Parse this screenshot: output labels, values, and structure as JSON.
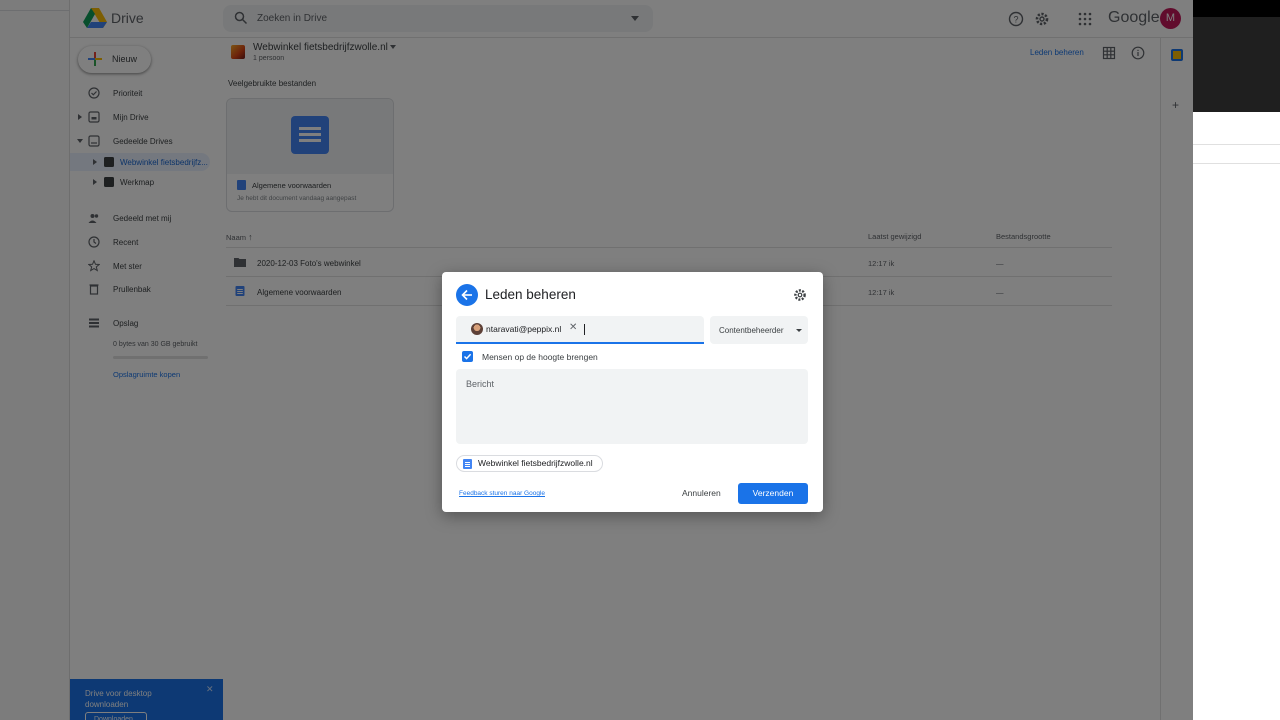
{
  "app": {
    "name": "Drive",
    "search_placeholder": "Zoeken in Drive",
    "brand": "Google",
    "avatar_initial": "M"
  },
  "sidebar": {
    "new_label": "Nieuw",
    "items": [
      {
        "label": "Prioriteit"
      },
      {
        "label": "Mijn Drive"
      },
      {
        "label": "Gedeelde Drives"
      },
      {
        "label": "Webwinkel fietsbedrijfz..."
      },
      {
        "label": "Werkmap"
      },
      {
        "label": "Gedeeld met mij"
      },
      {
        "label": "Recent"
      },
      {
        "label": "Met ster"
      },
      {
        "label": "Prullenbak"
      },
      {
        "label": "Opslag"
      }
    ],
    "storage_used": "0 bytes van 30 GB gebruikt",
    "buy_storage": "Opslagruimte kopen",
    "desktop_banner": {
      "text": "Drive voor desktop downloaden",
      "button": "Downloaden"
    }
  },
  "main": {
    "drive_title": "Webwinkel fietsbedrijfzwolle.nl",
    "members": "1 persoon",
    "manage_members": "Leden beheren",
    "suggested_heading": "Veelgebruikte bestanden",
    "suggested_card": {
      "name": "Algemene voorwaarden",
      "subtitle": "Je hebt dit document vandaag aangepast"
    },
    "columns": {
      "name": "Naam",
      "modified": "Laatst gewijzigd",
      "size": "Bestandsgrootte"
    },
    "rows": [
      {
        "name": "2020-12-03 Foto's webwinkel",
        "modified": "12:17 ik",
        "size": "—",
        "type": "folder-icon"
      },
      {
        "name": "Algemene voorwaarden",
        "modified": "12:17 ik",
        "size": "—",
        "type": "doc-icon"
      }
    ]
  },
  "dialog": {
    "title": "Leden beheren",
    "chip_email": "ntaravati@peppix.nl",
    "role": "Contentbeheerder",
    "notify_label": "Mensen op de hoogte brengen",
    "notify_checked": true,
    "message_placeholder": "Bericht",
    "drive_chip": "Webwinkel fietsbedrijfzwolle.nl",
    "feedback": "Feedback sturen naar Google",
    "cancel": "Annuleren",
    "send": "Verzenden",
    "accent_color": "#1a73e8"
  }
}
